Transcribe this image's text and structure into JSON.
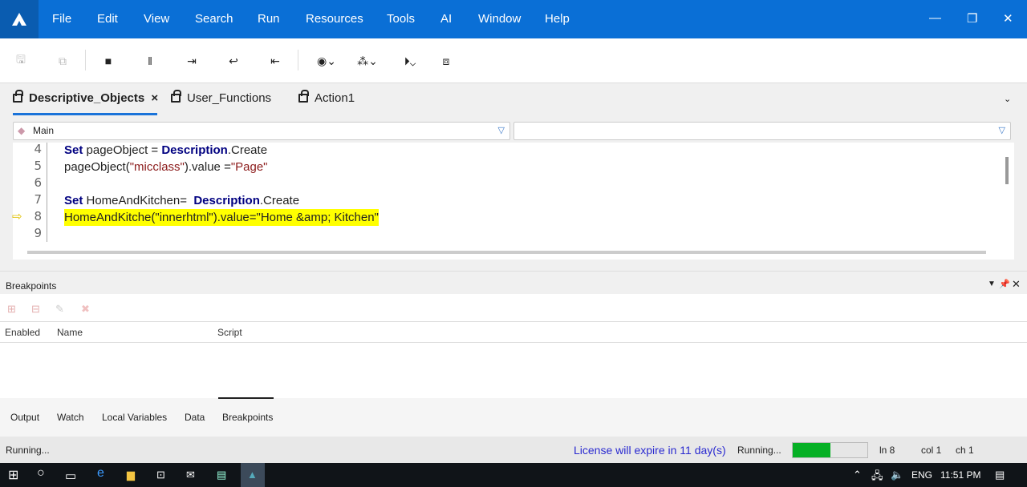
{
  "menu": [
    "File",
    "Edit",
    "View",
    "Search",
    "Run",
    "Resources",
    "Tools",
    "AI",
    "Window",
    "Help"
  ],
  "tabs": [
    {
      "label": "Descriptive_Objects",
      "active": true,
      "close": "×"
    },
    {
      "label": "User_Functions"
    },
    {
      "label": "Action1"
    }
  ],
  "combo": {
    "left": "Main",
    "right": ""
  },
  "editor": {
    "lines": [
      {
        "n": "4"
      },
      {
        "n": "5"
      },
      {
        "n": "6"
      },
      {
        "n": "7"
      },
      {
        "n": "8"
      },
      {
        "n": "9"
      }
    ],
    "l4": {
      "kw": "Set",
      "a": " pageObject = ",
      "kw2": "Description",
      ".b": ".Create"
    },
    "l4b": ".Create",
    "l5a": "pageObject(",
    "l5s": "\"micclass\"",
    "l5b": ").value =",
    "l5s2": "\"Page\"",
    "l7a": " HomeAndKitchen=  ",
    "l8": "HomeAndKitche(\"innerhtml\").value=\"Home &amp; Kitchen\""
  },
  "breakpoints": {
    "title": "Breakpoints",
    "columns": [
      "Enabled",
      "Name",
      "Script"
    ],
    "rows": []
  },
  "bottom_tabs": [
    "Output",
    "Watch",
    "Local Variables",
    "Data",
    "Breakpoints"
  ],
  "status": {
    "left": "Running...",
    "license": "License will expire in 11 day(s)",
    "running": "Running...",
    "progress": 0.5,
    "ln": "ln 8",
    "col": "col 1",
    "ch": "ch 1"
  },
  "taskbar": {
    "lang": "ENG",
    "time": "11:51 PM"
  },
  "colors": {
    "title": "#0a6fd6",
    "accent": "#1a73d9",
    "progress": "#06b025"
  }
}
